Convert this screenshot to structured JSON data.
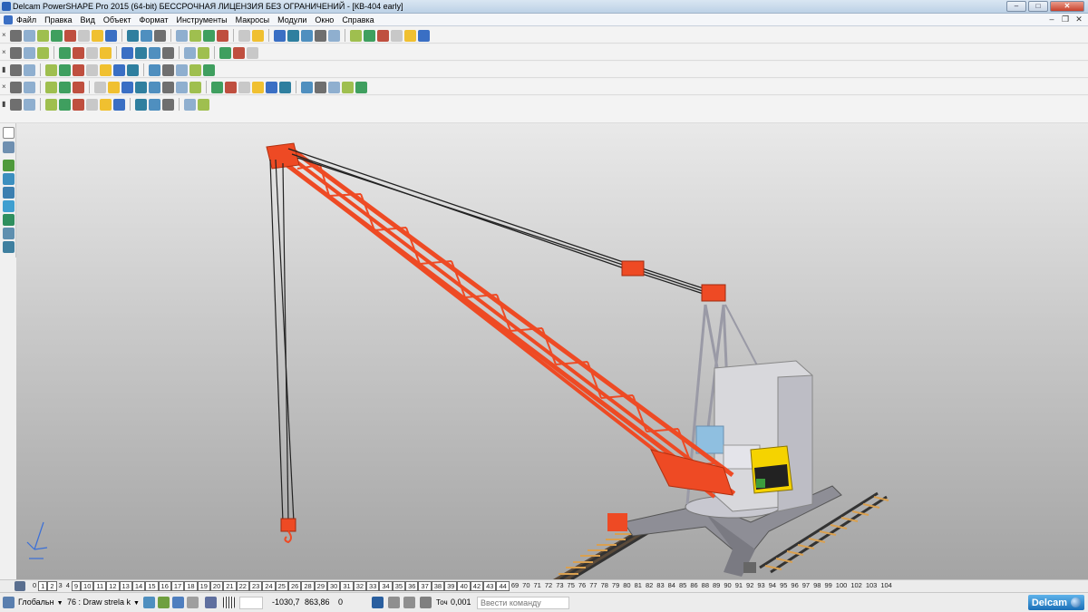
{
  "window": {
    "title": "Delcam PowerSHAPE Pro 2015 (64-bit) БЕССРОЧНАЯ ЛИЦЕНЗИЯ БЕЗ ОГРАНИЧЕНИЙ - [КВ-404 early]",
    "controls": {
      "minimize": "–",
      "maximize": "□",
      "close": "✕"
    }
  },
  "menubar": {
    "items": [
      "Файл",
      "Правка",
      "Вид",
      "Объект",
      "Формат",
      "Инструменты",
      "Макросы",
      "Модули",
      "Окно",
      "Справка"
    ],
    "mdi_controls": {
      "minimize": "–",
      "restore": "❐",
      "close": "✕"
    }
  },
  "toolbars": {
    "close_glyph": "×"
  },
  "layers": {
    "items": [
      "0",
      "1",
      "2",
      "3",
      "4",
      "9",
      "10",
      "11",
      "12",
      "13",
      "14",
      "15",
      "16",
      "17",
      "18",
      "19",
      "20",
      "21",
      "22",
      "23",
      "24",
      "25",
      "26",
      "28",
      "29",
      "30",
      "31",
      "32",
      "33",
      "34",
      "35",
      "36",
      "37",
      "38",
      "39",
      "40",
      "42",
      "43",
      "44",
      "69",
      "70",
      "71",
      "72",
      "73",
      "75",
      "76",
      "77",
      "78",
      "79",
      "80",
      "81",
      "82",
      "83",
      "84",
      "85",
      "86",
      "88",
      "89",
      "90",
      "91",
      "92",
      "93",
      "94",
      "95",
      "96",
      "97",
      "98",
      "99",
      "100",
      "102",
      "103",
      "104"
    ],
    "active": [
      "1",
      "2",
      "9",
      "10",
      "11",
      "12",
      "13",
      "14",
      "15",
      "16",
      "17",
      "18",
      "19",
      "20",
      "21",
      "22",
      "23",
      "24",
      "25",
      "26",
      "28",
      "29",
      "30",
      "31",
      "32",
      "33",
      "34",
      "35",
      "36",
      "37",
      "38",
      "39",
      "40",
      "42",
      "43",
      "44"
    ]
  },
  "status": {
    "workplane": "Глобальн",
    "level": "76 : Draw strela k",
    "x": "-1030,7",
    "y": "863,86",
    "z": "0",
    "tolerance_label": "Точ",
    "tolerance": "0,001",
    "command_placeholder": "Ввести команду",
    "brand": "Delcam"
  },
  "colors": {
    "crane_boom": "#ee4a24",
    "cab": "#f5d300",
    "viewport_top": "#e9e9e9",
    "viewport_bottom": "#a4a4a4"
  }
}
